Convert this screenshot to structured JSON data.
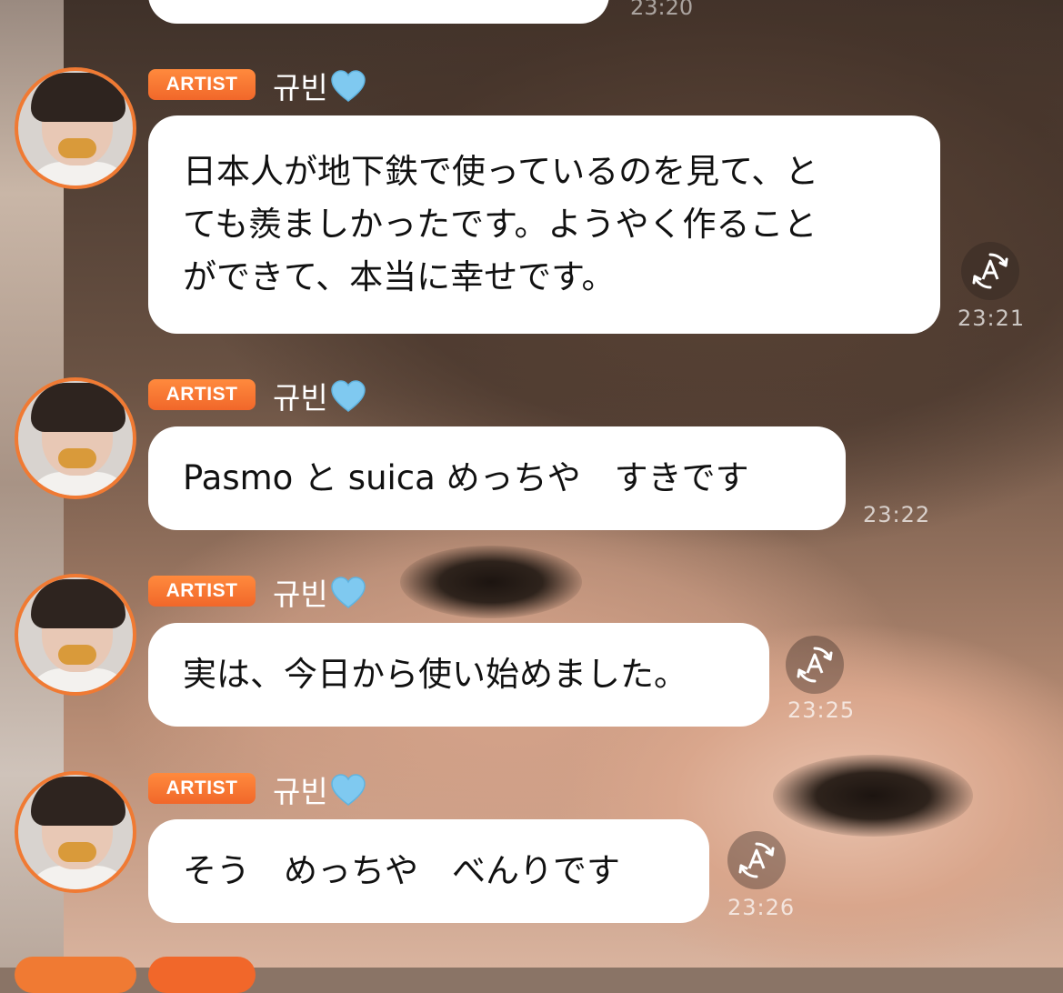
{
  "previous": {
    "time": "23:20"
  },
  "messages": [
    {
      "badge": "ARTIST",
      "sender": "규빈",
      "text": "日本人が地下鉄で使っているのを見て、と\nても羨ましかったです。ようやく作ること\nができて、本当に幸せです。",
      "time": "23:21",
      "translate_icon": "translate-icon"
    },
    {
      "badge": "ARTIST",
      "sender": "규빈",
      "text": "Pasmo と suica めっちや　すきです",
      "time": "23:22"
    },
    {
      "badge": "ARTIST",
      "sender": "규빈",
      "text": "実は、今日から使い始めました。",
      "time": "23:25",
      "translate_icon": "translate-icon"
    },
    {
      "badge": "ARTIST",
      "sender": "규빈",
      "text": "そう　めっちや　べんりです",
      "time": "23:26",
      "translate_icon": "translate-icon"
    }
  ],
  "colors": {
    "accent": "#f07a33",
    "heart": "#7fc9f0",
    "bubble": "#ffffff"
  }
}
